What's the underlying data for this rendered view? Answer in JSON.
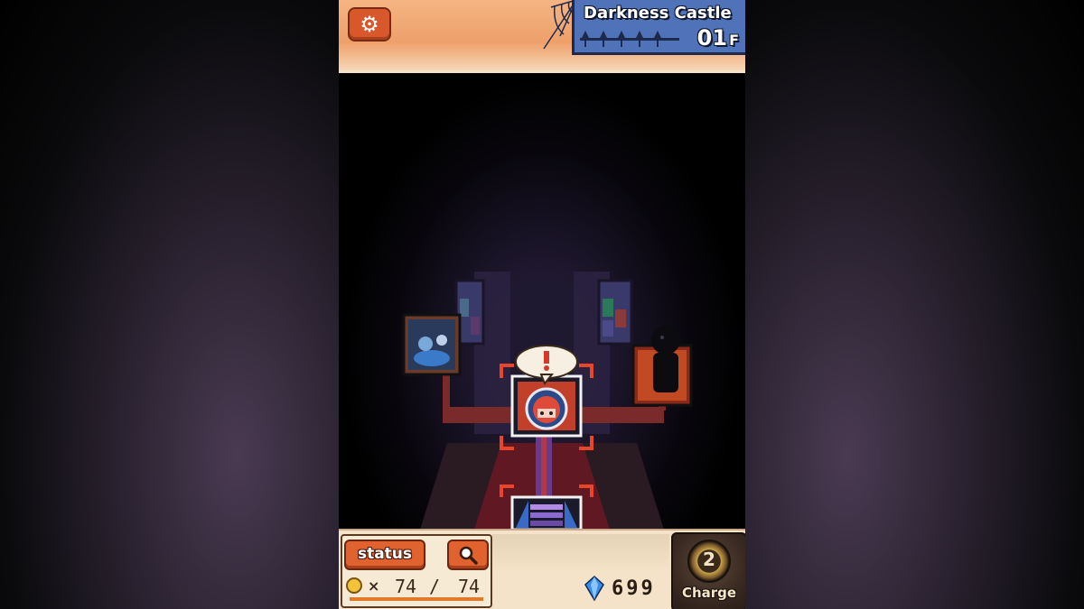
{
  "hud": {
    "location_name": "Darkness Castle",
    "floor_number": "01",
    "floor_unit": "F",
    "settings_icon": "gear-icon"
  },
  "status": {
    "button_label": "status",
    "search_icon": "magnifier-icon",
    "hp_prefix": "×",
    "hp_current": "74",
    "hp_separator": "/",
    "hp_max": "74",
    "hp_fraction": 1.0
  },
  "resources": {
    "crystal_icon": "blue-crystal-icon",
    "crystal_count": "699"
  },
  "charge": {
    "count": "2",
    "label": "Charge"
  },
  "map": {
    "player_room_alert_icon": "exclamation-bubble-icon",
    "player_icon": "red-haired-hero-portrait-icon",
    "left_room_icon": "blue-ghost-monster-icon",
    "right_room_icon": "shadow-figure-icon",
    "stairs_icon": "stairs-icon"
  },
  "colors": {
    "hud_orange": "#eea06a",
    "location_blue": "#4f72b8",
    "button_red": "#e0622f",
    "selection_bracket": "#e8452a"
  }
}
